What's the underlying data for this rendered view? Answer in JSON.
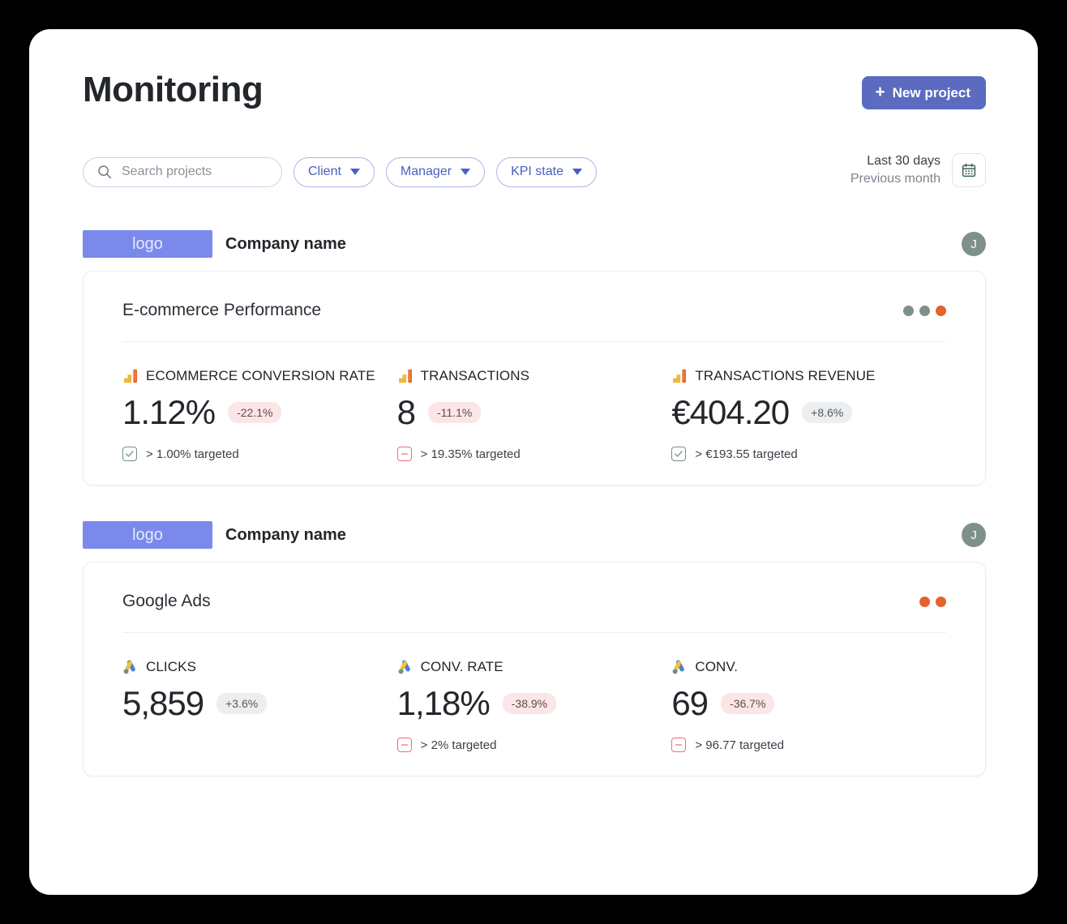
{
  "header": {
    "title": "Monitoring",
    "new_project_label": "New project",
    "plus_icon": "plus-icon"
  },
  "filters": {
    "search_placeholder": "Search projects",
    "search_value": "",
    "search_icon": "search-icon",
    "pills": [
      {
        "label": "Client",
        "icon": "chevron-down-icon"
      },
      {
        "label": "Manager",
        "icon": "chevron-down-icon"
      },
      {
        "label": "KPI state",
        "icon": "chevron-down-icon"
      }
    ],
    "date_range": {
      "primary": "Last 30 days",
      "secondary": "Previous month",
      "icon": "calendar-icon"
    }
  },
  "colors": {
    "accent": "#5b6bc0",
    "logo_chip": "#7b89ec",
    "avatar": "#7e9189",
    "dot_green": "#7e9189",
    "dot_orange": "#e4622b",
    "badge_negative_bg": "#fbe5e6",
    "badge_positive_bg": "#eceef0",
    "check_ok": "#6f9185",
    "check_bad": "#e8707a"
  },
  "companies": [
    {
      "logo_text": "logo",
      "name": "Company name",
      "avatar_initial": "J",
      "card": {
        "title": "E-commerce Performance",
        "status_dots": [
          "#7e9189",
          "#7e9189",
          "#e4622b"
        ],
        "kpis": [
          {
            "icon": "google-analytics-icon",
            "label": "ECOMMERCE CONVERSION RATE",
            "value": "1.12%",
            "delta": "-22.1%",
            "delta_direction": "negative",
            "target_state": "met",
            "target_text": "> 1.00% targeted"
          },
          {
            "icon": "google-analytics-icon",
            "label": "TRANSACTIONS",
            "value": "8",
            "delta": "-11.1%",
            "delta_direction": "negative",
            "target_state": "missed",
            "target_text": "> 19.35% targeted"
          },
          {
            "icon": "google-analytics-icon",
            "label": "TRANSACTIONS REVENUE",
            "value": "€404.20",
            "delta": "+8.6%",
            "delta_direction": "positive",
            "target_state": "met",
            "target_text": "> €193.55 targeted"
          }
        ]
      }
    },
    {
      "logo_text": "logo",
      "name": "Company name",
      "avatar_initial": "J",
      "card": {
        "title": "Google Ads",
        "status_dots": [
          "#e4622b",
          "#e4622b"
        ],
        "kpis": [
          {
            "icon": "google-ads-icon",
            "label": "CLICKS",
            "value": "5,859",
            "delta": "+3.6%",
            "delta_direction": "positive",
            "target_state": "none",
            "target_text": ""
          },
          {
            "icon": "google-ads-icon",
            "label": "CONV. RATE",
            "value": "1,18%",
            "delta": "-38.9%",
            "delta_direction": "negative",
            "target_state": "missed",
            "target_text": "> 2% targeted"
          },
          {
            "icon": "google-ads-icon",
            "label": "CONV.",
            "value": "69",
            "delta": "-36.7%",
            "delta_direction": "negative",
            "target_state": "missed",
            "target_text": "> 96.77 targeted"
          }
        ]
      }
    }
  ]
}
